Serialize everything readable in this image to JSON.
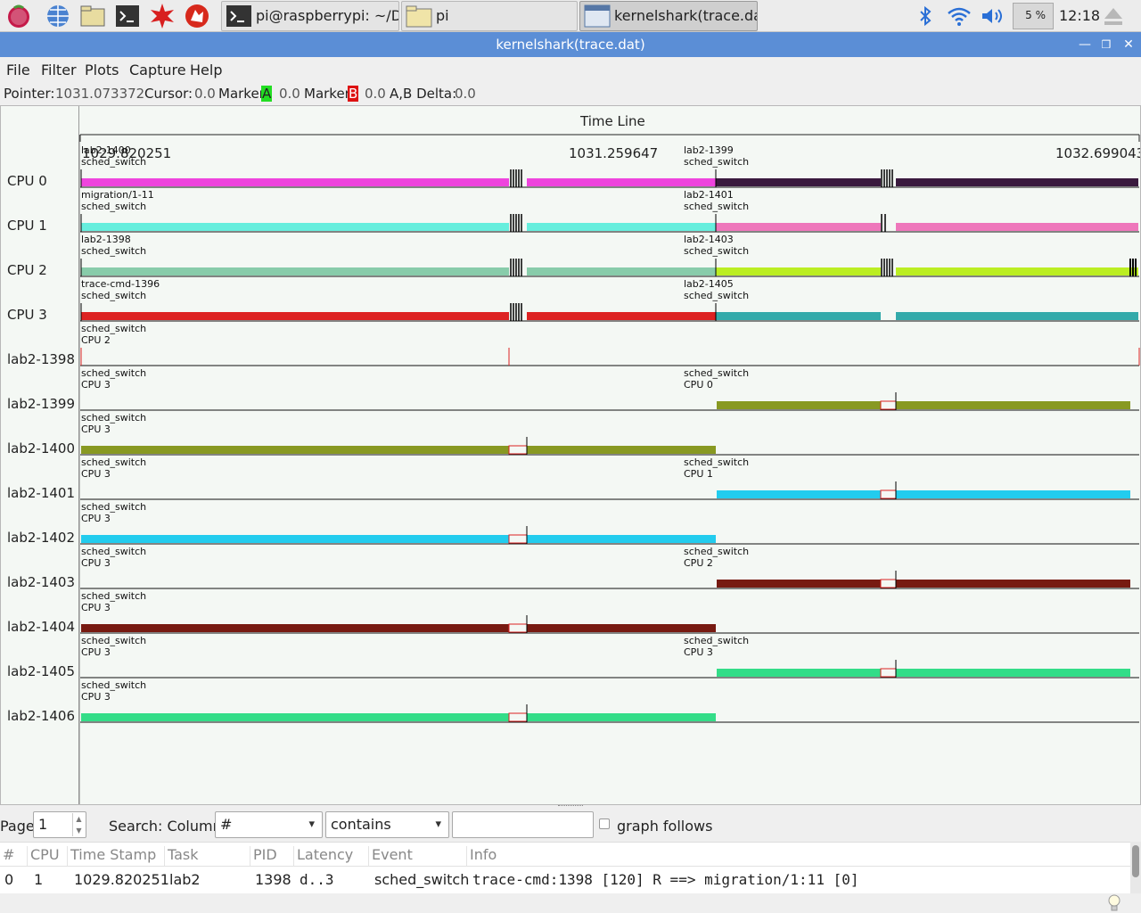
{
  "taskbar": {
    "tasks": [
      {
        "label": "pi@raspberrypi: ~/D...",
        "icon": "terminal-icon"
      },
      {
        "label": "pi",
        "icon": "folder-icon"
      },
      {
        "label": "kernelshark(trace.dat)",
        "icon": "window-icon",
        "active": true
      }
    ],
    "cpu_usage": "5 %",
    "clock": "12:18"
  },
  "window": {
    "title": "kernelshark(trace.dat)"
  },
  "menu": [
    "File",
    "Filter",
    "Plots",
    "Capture",
    "Help"
  ],
  "info": {
    "pointer_label": "Pointer:",
    "pointer_value": "1031.073372",
    "cursor_label": "Cursor:",
    "cursor_value": "0.0",
    "markerA_label": "Marker",
    "markerA_letter": "A",
    "markerA_value": "0.0",
    "markerB_label": "Marker",
    "markerB_letter": "B",
    "markerB_value": "0.0",
    "delta_label": "A,B Delta:",
    "delta_value": "0.0",
    "markerA_color": "#22dd22",
    "markerB_color": "#dd1111"
  },
  "timeline": {
    "title": "Time Line",
    "ticks": [
      "1029.820251",
      "1031.259647",
      "1032.699043"
    ]
  },
  "rows": [
    {
      "label": "CPU 0",
      "colors": [
        "#ee44dd",
        "#ee44dd",
        "#3a1a3e",
        "#3a1a3e"
      ],
      "ann_left": [
        "lab2-1400",
        "sched_switch"
      ],
      "ann_right": [
        "lab2-1399",
        "sched_switch"
      ],
      "type": "cpu"
    },
    {
      "label": "CPU 1",
      "colors": [
        "#66eedd",
        "#66eedd",
        "#ee77bb",
        "#ee77bb"
      ],
      "ann_left": [
        "migration/1-11",
        "sched_switch"
      ],
      "ann_right": [
        "lab2-1401",
        "sched_switch"
      ],
      "type": "cpu"
    },
    {
      "label": "CPU 2",
      "colors": [
        "#88ccaa",
        "#88ccaa",
        "#bbee22",
        "#bbee22"
      ],
      "ann_left": [
        "lab2-1398",
        "sched_switch"
      ],
      "ann_right": [
        "lab2-1403",
        "sched_switch"
      ],
      "type": "cpu"
    },
    {
      "label": "CPU 3",
      "colors": [
        "#dd2222",
        "#dd2222",
        "#33aaaa",
        "#33aaaa"
      ],
      "ann_left": [
        "trace-cmd-1396",
        "sched_switch"
      ],
      "ann_right": [
        "lab2-1405",
        "sched_switch"
      ],
      "type": "cpu"
    },
    {
      "label": "lab2-1398",
      "colors": [],
      "ann_left": [
        "sched_switch",
        "CPU 2"
      ],
      "ann_right": [],
      "type": "task",
      "span": "none"
    },
    {
      "label": "lab2-1399",
      "colors": [
        "#889922"
      ],
      "ann_left": [
        "sched_switch",
        "CPU 3"
      ],
      "ann_right": [
        "sched_switch",
        "CPU 0"
      ],
      "type": "task",
      "span": "right"
    },
    {
      "label": "lab2-1400",
      "colors": [
        "#889922"
      ],
      "ann_left": [
        "sched_switch",
        "CPU 3"
      ],
      "ann_right": [],
      "type": "task",
      "span": "left"
    },
    {
      "label": "lab2-1401",
      "colors": [
        "#22ccee"
      ],
      "ann_left": [
        "sched_switch",
        "CPU 3"
      ],
      "ann_right": [
        "sched_switch",
        "CPU 1"
      ],
      "type": "task",
      "span": "right"
    },
    {
      "label": "lab2-1402",
      "colors": [
        "#22ccee"
      ],
      "ann_left": [
        "sched_switch",
        "CPU 3"
      ],
      "ann_right": [],
      "type": "task",
      "span": "left"
    },
    {
      "label": "lab2-1403",
      "colors": [
        "#771a11"
      ],
      "ann_left": [
        "sched_switch",
        "CPU 3"
      ],
      "ann_right": [
        "sched_switch",
        "CPU 2"
      ],
      "type": "task",
      "span": "right"
    },
    {
      "label": "lab2-1404",
      "colors": [
        "#771a11"
      ],
      "ann_left": [
        "sched_switch",
        "CPU 3"
      ],
      "ann_right": [],
      "type": "task",
      "span": "left"
    },
    {
      "label": "lab2-1405",
      "colors": [
        "#33dd88"
      ],
      "ann_left": [
        "sched_switch",
        "CPU 3"
      ],
      "ann_right": [
        "sched_switch",
        "CPU 3"
      ],
      "type": "task",
      "span": "right"
    },
    {
      "label": "lab2-1406",
      "colors": [
        "#33dd88"
      ],
      "ann_left": [
        "sched_switch",
        "CPU 3"
      ],
      "ann_right": [],
      "type": "task",
      "span": "left"
    }
  ],
  "pagebar": {
    "page_label": "Page",
    "page_value": "1",
    "search_label": "Search: Column:",
    "column_value": "#",
    "match_value": "contains",
    "search_text": "",
    "graph_follows": "graph follows"
  },
  "table": {
    "headers": [
      "#",
      "CPU",
      "Time Stamp",
      "Task",
      "PID",
      "Latency",
      "Event",
      "Info"
    ],
    "rows": [
      [
        "0",
        "1",
        "1029.820251",
        "lab2",
        "1398",
        "d..3",
        "sched_switch",
        "trace-cmd:1398 [120] R ==> migration/1:11 [0]"
      ]
    ]
  }
}
